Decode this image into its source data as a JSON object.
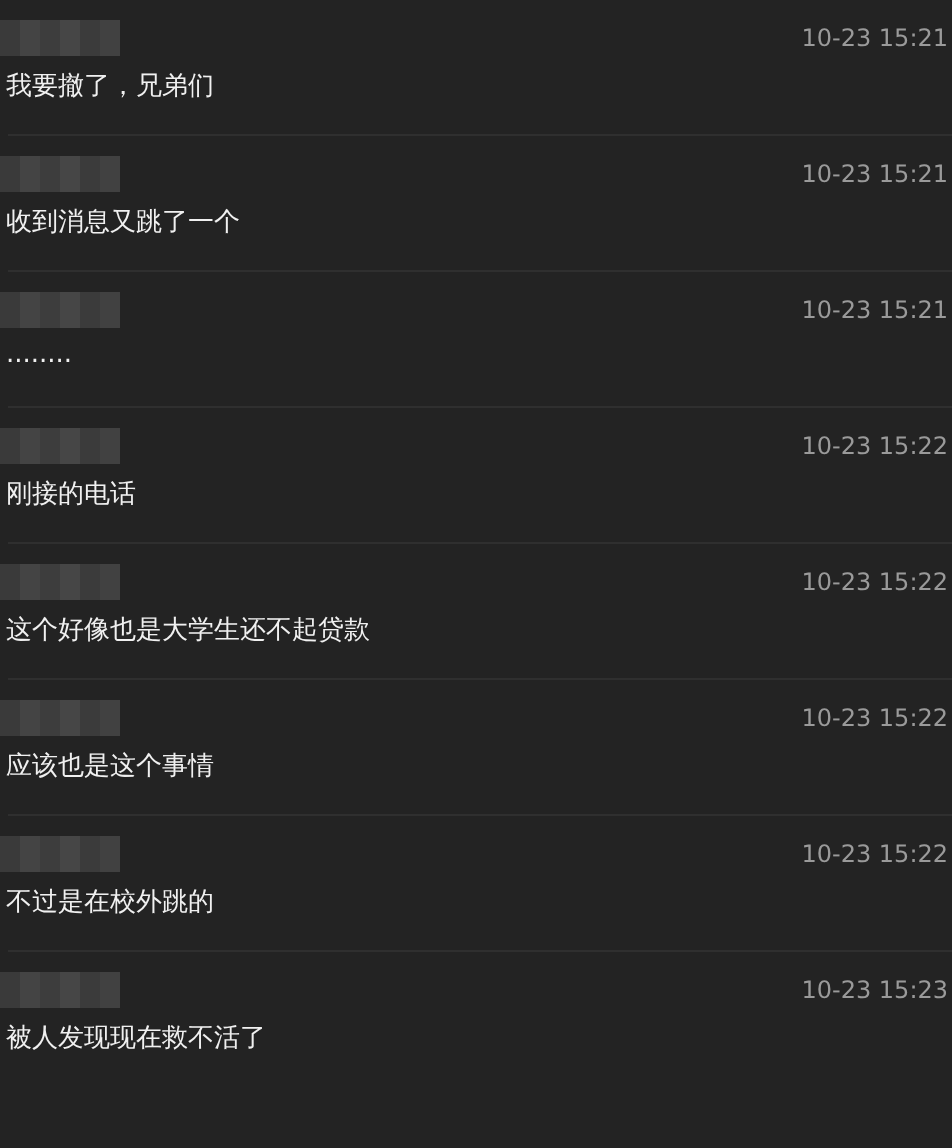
{
  "messages": [
    {
      "time": "10-23 15:21",
      "text": "我要撤了，兄弟们"
    },
    {
      "time": "10-23 15:21",
      "text": "收到消息又跳了一个"
    },
    {
      "time": "10-23 15:21",
      "text": "........"
    },
    {
      "time": "10-23 15:22",
      "text": "刚接的电话"
    },
    {
      "time": "10-23 15:22",
      "text": "这个好像也是大学生还不起贷款"
    },
    {
      "time": "10-23 15:22",
      "text": "应该也是这个事情"
    },
    {
      "time": "10-23 15:22",
      "text": "不过是在校外跳的"
    },
    {
      "time": "10-23 15:23",
      "text": "被人发现现在救不活了"
    }
  ]
}
